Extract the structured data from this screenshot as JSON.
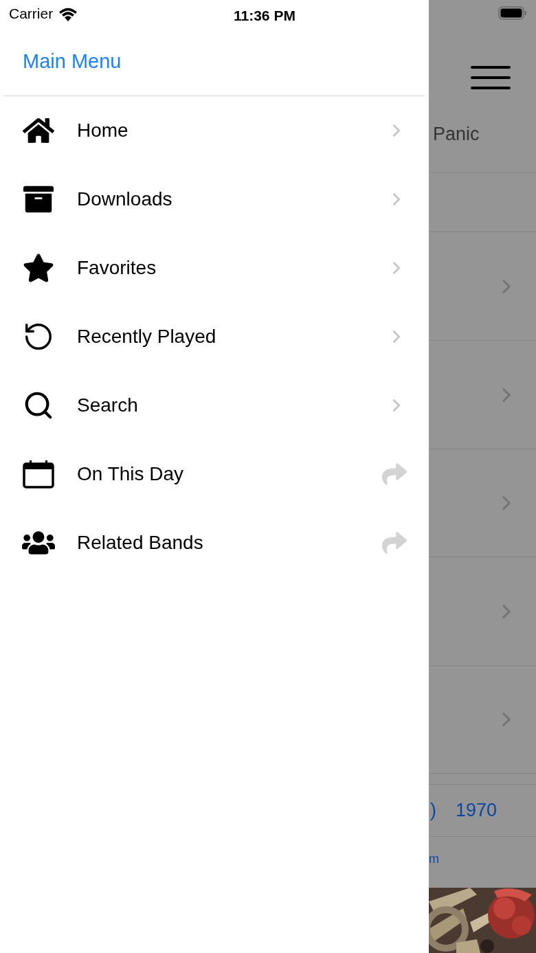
{
  "status_bar": {
    "carrier": "Carrier",
    "time": "11:36 PM"
  },
  "drawer": {
    "title": "Main Menu",
    "items": [
      {
        "label": "Home",
        "kind": "chevron"
      },
      {
        "label": "Downloads",
        "kind": "chevron"
      },
      {
        "label": "Favorites",
        "kind": "chevron"
      },
      {
        "label": "Recently Played",
        "kind": "chevron"
      },
      {
        "label": "Search",
        "kind": "chevron"
      },
      {
        "label": "On This Day",
        "kind": "forward"
      },
      {
        "label": "Related Bands",
        "kind": "forward"
      }
    ]
  },
  "background": {
    "title_fragment": "Panic",
    "year_fragment": ")",
    "year": "1970",
    "link_fragment": "m"
  }
}
